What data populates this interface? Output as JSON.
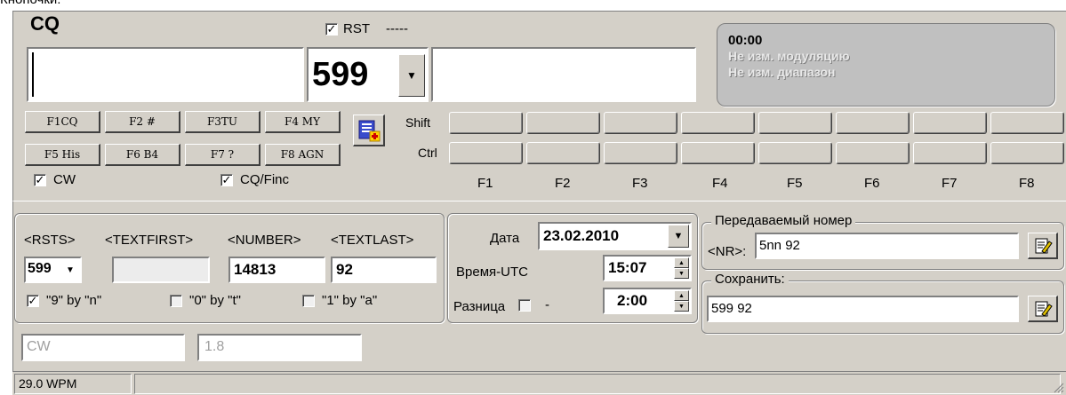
{
  "partial_title": "Кнопочки:",
  "top": {
    "cq_label": "CQ",
    "rst_label": "RST",
    "rst_dashes": "-----",
    "rst_value": "599",
    "info_time": "00:00",
    "info_line1": "Не изм. модуляцию",
    "info_line2": "Не изм. диапазон"
  },
  "macro_buttons": [
    "F1CQ",
    "F2 #",
    "F3TU",
    "F4 MY",
    "F5 His",
    "F6 B4",
    "F7 ?",
    "F8 AGN"
  ],
  "shift_label": "Shift",
  "ctrl_label": "Ctrl",
  "fkey_labels": [
    "F1",
    "F2",
    "F3",
    "F4",
    "F5",
    "F6",
    "F7",
    "F8"
  ],
  "cw_check_label": "CW",
  "cqfinc_check_label": "CQ/Finc",
  "fields": {
    "rsts_header": "<RSTS>",
    "textfirst_header": "<TEXTFIRST>",
    "number_header": "<NUMBER>",
    "textlast_header": "<TEXTLAST>",
    "rsts_value": "599",
    "textfirst_value": "",
    "number_value": "14813",
    "textlast_value": "92",
    "opt_9n": "\"9\" by \"n\"",
    "opt_0t": "\"0\" by \"t\"",
    "opt_1a": "\"1\" by \"a\""
  },
  "datetime": {
    "date_label": "Дата",
    "date_value": "23.02.2010",
    "utc_label": "Время-UTC",
    "utc_value": "15:07",
    "diff_label": "Разница",
    "diff_sign": "-",
    "diff_value": "2:00"
  },
  "transmit": {
    "group_label": "Передаваемый номер",
    "nr_label": "<NR>:",
    "nr_value": "5nn 92",
    "save_group_label": "Сохранить:",
    "save_value": "599 92"
  },
  "bottom": {
    "mode_value": "CW",
    "band_value": "1.8",
    "status_wpm": "29.0 WPM"
  },
  "colors": {
    "panel_bg": "#d4d0c8",
    "info_panel_bg": "#c0c0c0",
    "info_text": "#000000",
    "info_dim_text": "#e8e8e8"
  }
}
